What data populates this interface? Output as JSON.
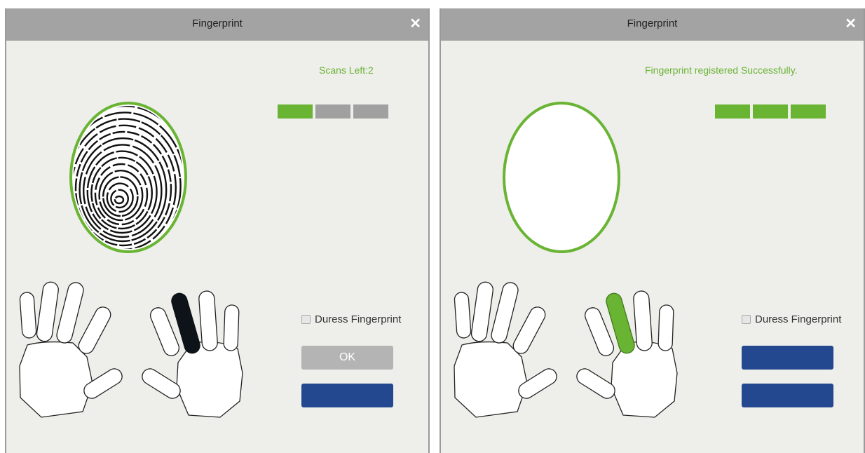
{
  "left_dialog": {
    "title": "Fingerprint",
    "close_icon": "close-icon",
    "status_text": "Scans Left:2",
    "scan_progress": {
      "completed": 1,
      "total": 3
    },
    "duress_label": "Duress Fingerprint",
    "duress_checked": false,
    "ok_label": "OK",
    "cancel_label": "",
    "selected_finger": "left-index",
    "selected_finger_color": "#0d1318"
  },
  "right_dialog": {
    "title": "Fingerprint",
    "close_icon": "close-icon",
    "status_text": "Fingerprint registered Successfully.",
    "scan_progress": {
      "completed": 3,
      "total": 3
    },
    "duress_label": "Duress Fingerprint",
    "duress_checked": false,
    "ok_label": "",
    "cancel_label": "",
    "selected_finger": "left-index",
    "selected_finger_color": "#69b433"
  },
  "colors": {
    "accent_green": "#69b433",
    "titlebar_grey": "#a3a3a3",
    "primary_blue": "#23488f",
    "disabled_grey": "#b4b4b4"
  }
}
